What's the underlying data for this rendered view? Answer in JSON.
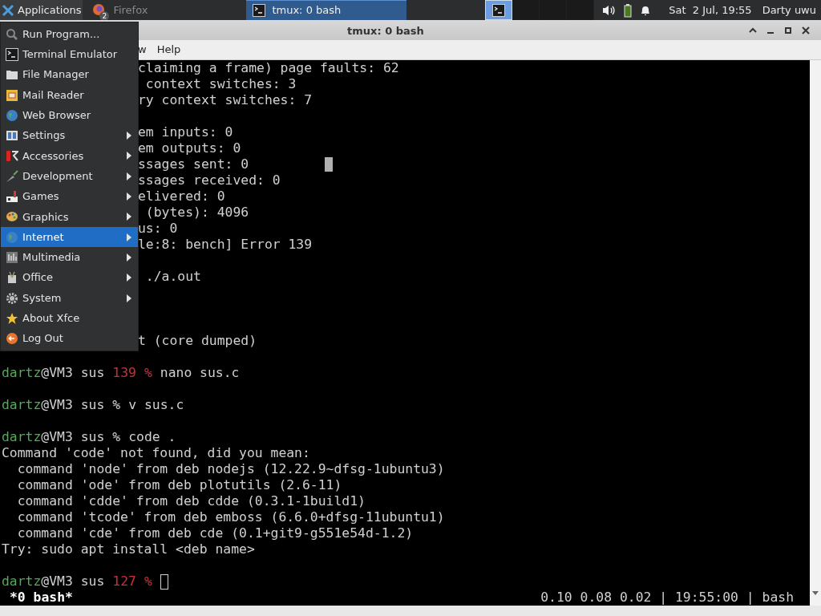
{
  "panel": {
    "applications": "Applications",
    "tasks": [
      {
        "label": "Firefox",
        "badge": "2",
        "selected": false
      },
      {
        "label": "tmux: 0 bash",
        "selected": true
      }
    ],
    "workspaces": [
      {
        "selected": true
      },
      {
        "selected": false
      },
      {
        "selected": false
      },
      {
        "selected": false
      }
    ],
    "clock": "Sat  2 Jul, 19:55",
    "user": "Darty uwu"
  },
  "window": {
    "title": "tmux: 0 bash",
    "menubar": [
      "w",
      "Help"
    ]
  },
  "terminal": {
    "lines": [
      {
        "kind": "output",
        "text": "claiming a frame) page faults: 62",
        "clipped": true
      },
      {
        "kind": "output",
        "text": " context switches: 3",
        "clipped": true
      },
      {
        "kind": "output",
        "text": "ry context switches: 7",
        "clipped": true
      },
      {
        "kind": "blank"
      },
      {
        "kind": "output",
        "text": "em inputs: 0",
        "clipped": true
      },
      {
        "kind": "output",
        "text": "em outputs: 0",
        "clipped": true
      },
      {
        "kind": "output",
        "text": "ssages sent: 0",
        "clipped": true,
        "stray_cursor": true
      },
      {
        "kind": "output",
        "text": "ssages received: 0",
        "clipped": true
      },
      {
        "kind": "output",
        "text": "elivered: 0",
        "clipped": true
      },
      {
        "kind": "output",
        "text": " (bytes): 4096",
        "clipped": true
      },
      {
        "kind": "output",
        "text": "us: 0",
        "clipped": true
      },
      {
        "kind": "output",
        "text": "le:8: bench] Error 139",
        "clipped": true
      },
      {
        "kind": "blank"
      },
      {
        "kind": "output",
        "text": " ./a.out",
        "clipped": true
      },
      {
        "kind": "blank"
      },
      {
        "kind": "blank"
      },
      {
        "kind": "blank"
      },
      {
        "kind": "output",
        "text": "t (core dumped)",
        "clipped": true
      },
      {
        "kind": "blank"
      },
      {
        "kind": "prompt",
        "user": "dartz",
        "host": "@VM3 sus",
        "status": "139",
        "symbol": "%",
        "command": "nano sus.c"
      },
      {
        "kind": "blank"
      },
      {
        "kind": "prompt",
        "user": "dartz",
        "host": "@VM3 sus",
        "symbol": "%",
        "command": "v sus.c"
      },
      {
        "kind": "blank"
      },
      {
        "kind": "prompt",
        "user": "dartz",
        "host": "@VM3 sus",
        "symbol": "%",
        "command": "code ."
      },
      {
        "kind": "output",
        "text": "Command 'code' not found, did you mean:"
      },
      {
        "kind": "output",
        "text": "  command 'node' from deb nodejs (12.22.9~dfsg-1ubuntu3)"
      },
      {
        "kind": "output",
        "text": "  command 'ode' from deb plotutils (2.6-11)"
      },
      {
        "kind": "output",
        "text": "  command 'cdde' from deb cdde (0.3.1-1build1)"
      },
      {
        "kind": "output",
        "text": "  command 'tcode' from deb emboss (6.6.0+dfsg-11ubuntu1)"
      },
      {
        "kind": "output",
        "text": "  command 'cde' from deb cde (0.1+git9-g551e54d-1.2)"
      },
      {
        "kind": "output",
        "text": "Try: sudo apt install <deb name>"
      },
      {
        "kind": "blank"
      },
      {
        "kind": "prompt",
        "user": "dartz",
        "host": "@VM3 sus",
        "status": "127",
        "symbol": "%",
        "cursor": true
      }
    ],
    "status_left": "*0 bash*",
    "status_right": "0.10 0.08 0.02 | 19:55:00 | bash"
  },
  "menu": [
    {
      "label": "Run Program...",
      "submenu": false,
      "selected": false
    },
    {
      "label": "Terminal Emulator",
      "submenu": false,
      "selected": false
    },
    {
      "label": "File Manager",
      "submenu": false,
      "selected": false
    },
    {
      "label": "Mail Reader",
      "submenu": false,
      "selected": false
    },
    {
      "label": "Web Browser",
      "submenu": false,
      "selected": false
    },
    {
      "label": "Settings",
      "submenu": true,
      "selected": false
    },
    {
      "label": "Accessories",
      "submenu": true,
      "selected": false
    },
    {
      "label": "Development",
      "submenu": true,
      "selected": false
    },
    {
      "label": "Games",
      "submenu": true,
      "selected": false
    },
    {
      "label": "Graphics",
      "submenu": true,
      "selected": false
    },
    {
      "label": "Internet",
      "submenu": true,
      "selected": true
    },
    {
      "label": "Multimedia",
      "submenu": true,
      "selected": false
    },
    {
      "label": "Office",
      "submenu": true,
      "selected": false
    },
    {
      "label": "System",
      "submenu": true,
      "selected": false
    },
    {
      "label": "About Xfce",
      "submenu": false,
      "selected": false
    },
    {
      "label": "Log Out",
      "submenu": false,
      "selected": false
    }
  ]
}
